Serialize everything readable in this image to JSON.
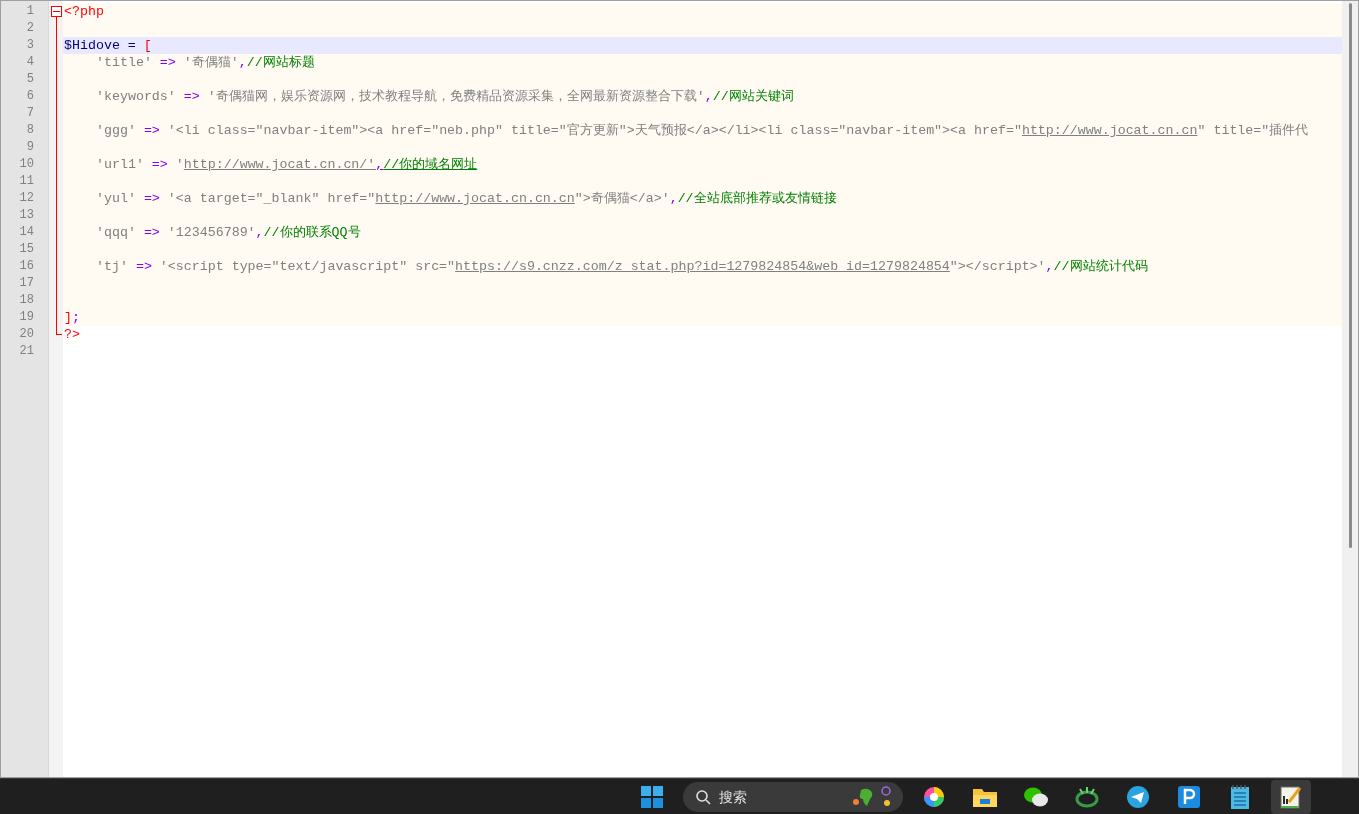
{
  "editor": {
    "lines": [
      {
        "number": "1",
        "kind": "fold-start",
        "current": false,
        "indented": false,
        "tokens": [
          {
            "kind": "tag",
            "text": "<?php"
          }
        ]
      },
      {
        "number": "2",
        "kind": "fold-mid",
        "current": false
      },
      {
        "number": "3",
        "kind": "fold-mid",
        "current": true,
        "indented": false,
        "tokens": [
          {
            "kind": "var",
            "text": "$Hidove = "
          },
          {
            "kind": "tag",
            "text": "["
          }
        ]
      },
      {
        "number": "4",
        "kind": "fold-mid",
        "current": false,
        "indented": true,
        "tokens": [
          {
            "kind": "str",
            "text": "'title'"
          },
          {
            "kind": "op",
            "text": " => "
          },
          {
            "kind": "str",
            "text": "'奇偶猫'"
          },
          {
            "kind": "op",
            "text": ","
          },
          {
            "kind": "comment",
            "text": "//网站标题"
          }
        ]
      },
      {
        "number": "5",
        "kind": "fold-mid",
        "current": false
      },
      {
        "number": "6",
        "kind": "fold-mid",
        "current": false,
        "indented": true,
        "tokens": [
          {
            "kind": "str",
            "text": "'keywords'"
          },
          {
            "kind": "op",
            "text": " => "
          },
          {
            "kind": "str",
            "text": "'奇偶猫网，娱乐资源网，技术教程导航，免费精品资源采集，全网最新资源整合下载'"
          },
          {
            "kind": "op",
            "text": ","
          },
          {
            "kind": "comment",
            "text": "//网站关键词"
          }
        ]
      },
      {
        "number": "7",
        "kind": "fold-mid",
        "current": false
      },
      {
        "number": "8",
        "kind": "fold-mid",
        "current": false,
        "indented": true,
        "tokens": [
          {
            "kind": "str",
            "text": "'ggg'"
          },
          {
            "kind": "op",
            "text": " => "
          },
          {
            "kind": "str",
            "text": "'<li class=\"navbar-item\"><a href=\"neb.php\" title=\"官方更新\">天气预报</a></li><li class=\"navbar-item\"><a href=\""
          },
          {
            "kind": "str",
            "underline": true,
            "text": "http://www.jocat.cn.cn"
          },
          {
            "kind": "str",
            "text": "\" title=\"插件代"
          }
        ]
      },
      {
        "number": "9",
        "kind": "fold-mid",
        "current": false
      },
      {
        "number": "10",
        "kind": "fold-mid",
        "current": false,
        "indented": true,
        "tokens": [
          {
            "kind": "str",
            "text": "'url1'"
          },
          {
            "kind": "op",
            "text": " => "
          },
          {
            "kind": "str",
            "text": "'"
          },
          {
            "kind": "str",
            "underline": true,
            "text": "http://www.jocat.cn.cn/'"
          },
          {
            "kind": "op",
            "underline": true,
            "text": ","
          },
          {
            "kind": "comment",
            "underline": true,
            "text": "//你的域名网址"
          }
        ]
      },
      {
        "number": "11",
        "kind": "fold-mid",
        "current": false
      },
      {
        "number": "12",
        "kind": "fold-mid",
        "current": false,
        "indented": true,
        "tokens": [
          {
            "kind": "str",
            "text": "'yul'"
          },
          {
            "kind": "op",
            "text": " => "
          },
          {
            "kind": "str",
            "text": "'<a target=\"_blank\" href=\""
          },
          {
            "kind": "str",
            "underline": true,
            "text": "http://www.jocat.cn.cn.cn"
          },
          {
            "kind": "str",
            "text": "\">奇偶猫</a>'"
          },
          {
            "kind": "op",
            "text": ","
          },
          {
            "kind": "comment",
            "text": "//全站底部推荐或友情链接"
          }
        ]
      },
      {
        "number": "13",
        "kind": "fold-mid",
        "current": false
      },
      {
        "number": "14",
        "kind": "fold-mid",
        "current": false,
        "indented": true,
        "tokens": [
          {
            "kind": "str",
            "text": "'qqq'"
          },
          {
            "kind": "op",
            "text": " => "
          },
          {
            "kind": "str",
            "text": "'123456789'"
          },
          {
            "kind": "op",
            "text": ","
          },
          {
            "kind": "comment",
            "text": "//你的联系QQ号"
          }
        ]
      },
      {
        "number": "15",
        "kind": "fold-mid",
        "current": false
      },
      {
        "number": "16",
        "kind": "fold-mid",
        "current": false,
        "indented": true,
        "tokens": [
          {
            "kind": "str",
            "text": "'tj'"
          },
          {
            "kind": "op",
            "text": " => "
          },
          {
            "kind": "str",
            "text": "'<script type=\"text/javascript\" src=\""
          },
          {
            "kind": "str",
            "underline": true,
            "text": "https://s9.cnzz.com/z_stat.php?id=1279824854&web_id=1279824854"
          },
          {
            "kind": "str",
            "text": "\"></script>'"
          },
          {
            "kind": "op",
            "text": ","
          },
          {
            "kind": "comment",
            "text": "//网站统计代码"
          }
        ]
      },
      {
        "number": "17",
        "kind": "fold-mid",
        "current": false
      },
      {
        "number": "18",
        "kind": "fold-mid",
        "current": false
      },
      {
        "number": "19",
        "kind": "fold-mid",
        "current": false,
        "indented": false,
        "tokens": [
          {
            "kind": "tag",
            "text": "]"
          },
          {
            "kind": "op",
            "text": ";"
          }
        ]
      },
      {
        "number": "20",
        "kind": "fold-end",
        "current": false,
        "indented": false,
        "tokens": [
          {
            "kind": "tag",
            "text": "?>"
          }
        ]
      },
      {
        "number": "21",
        "kind": "plain",
        "current": false
      }
    ]
  },
  "taskbar": {
    "search": {
      "placeholder": "搜索"
    },
    "apps": [
      {
        "kind": "start",
        "selected": false
      },
      {
        "kind": "search"
      },
      {
        "kind": "colorwheel",
        "selected": false
      },
      {
        "kind": "folder",
        "selected": false
      },
      {
        "kind": "chat",
        "selected": false
      },
      {
        "kind": "game",
        "selected": false
      },
      {
        "kind": "plane",
        "selected": false
      },
      {
        "kind": "letterp",
        "selected": false
      },
      {
        "kind": "notepad",
        "selected": false
      },
      {
        "kind": "editor",
        "selected": true
      }
    ]
  }
}
